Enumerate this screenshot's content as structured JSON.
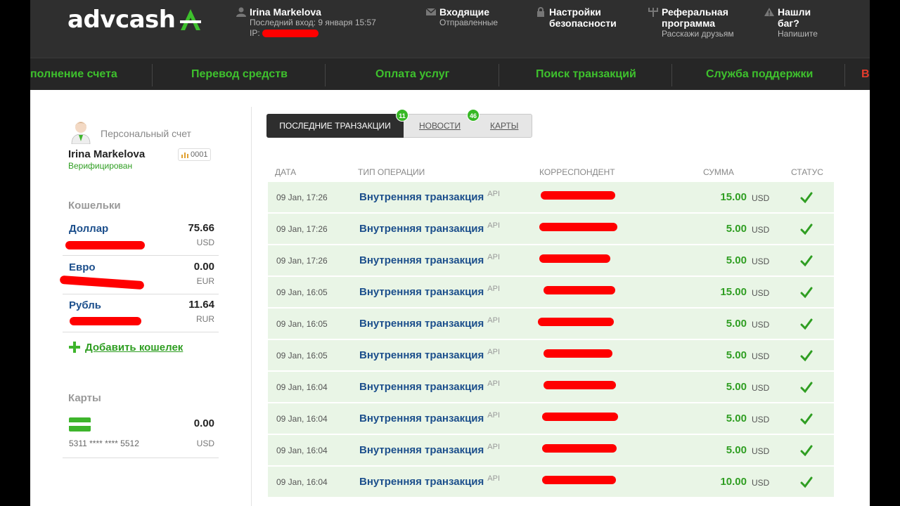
{
  "header": {
    "logo_text_1": "adv",
    "logo_text_2": "cash",
    "user_name": "Irina Markelova",
    "last_login": "Последний вход: 9 января 15:57",
    "ip_label": "IP:",
    "inbox_title": "Входящие",
    "inbox_sub": "Отправленные",
    "security_line1": "Настройки",
    "security_line2": "безопасности",
    "referral_line1": "Реферальная",
    "referral_line2": "программа",
    "referral_sub": "Расскажи друзьям",
    "bug_line1": "Нашли",
    "bug_line2": "баг?",
    "bug_sub": "Напишите"
  },
  "nav": {
    "items": [
      {
        "label": "полнение счета"
      },
      {
        "label": "Перевод средств"
      },
      {
        "label": "Оплата услуг"
      },
      {
        "label": "Поиск транзакций"
      },
      {
        "label": "Служба поддержки"
      },
      {
        "label": "В"
      }
    ]
  },
  "account": {
    "type": "Персональный счет",
    "name": "Irina Markelova",
    "status": "Верифицирован",
    "id": "0001"
  },
  "wallets": {
    "title": "Кошельки",
    "items": [
      {
        "name": "Доллар",
        "value": "75.66",
        "currency": "USD"
      },
      {
        "name": "Евро",
        "value": "0.00",
        "currency": "EUR"
      },
      {
        "name": "Рубль",
        "value": "11.64",
        "currency": "RUR"
      }
    ],
    "add_label": "Добавить кошелек"
  },
  "cards": {
    "title": "Карты",
    "number": "5311 **** **** 5512",
    "value": "0.00",
    "currency": "USD"
  },
  "tabs": {
    "last": "ПОСЛЕДНИЕ ТРАНЗАКЦИИ",
    "last_count": "11",
    "news": "НОВОСТИ",
    "news_count": "46",
    "cards": "КАРТЫ"
  },
  "table": {
    "headers": {
      "date": "ДАТА",
      "type": "ТИП ОПЕРАЦИИ",
      "correspondent": "КОРРЕСПОНДЕНТ",
      "amount": "СУММА",
      "status": "СТАТУС"
    },
    "rows": [
      {
        "date": "09 Jan, 17:26",
        "type": "Внутренняя транзакция",
        "api": "API",
        "amount": "15.00",
        "currency": "USD"
      },
      {
        "date": "09 Jan, 17:26",
        "type": "Внутренняя транзакция",
        "api": "API",
        "amount": "5.00",
        "currency": "USD"
      },
      {
        "date": "09 Jan, 17:26",
        "type": "Внутренняя транзакция",
        "api": "API",
        "amount": "5.00",
        "currency": "USD"
      },
      {
        "date": "09 Jan, 16:05",
        "type": "Внутренняя транзакция",
        "api": "API",
        "amount": "15.00",
        "currency": "USD"
      },
      {
        "date": "09 Jan, 16:05",
        "type": "Внутренняя транзакция",
        "api": "API",
        "amount": "5.00",
        "currency": "USD"
      },
      {
        "date": "09 Jan, 16:05",
        "type": "Внутренняя транзакция",
        "api": "API",
        "amount": "5.00",
        "currency": "USD"
      },
      {
        "date": "09 Jan, 16:04",
        "type": "Внутренняя транзакция",
        "api": "API",
        "amount": "5.00",
        "currency": "USD"
      },
      {
        "date": "09 Jan, 16:04",
        "type": "Внутренняя транзакция",
        "api": "API",
        "amount": "5.00",
        "currency": "USD"
      },
      {
        "date": "09 Jan, 16:04",
        "type": "Внутренняя транзакция",
        "api": "API",
        "amount": "5.00",
        "currency": "USD"
      },
      {
        "date": "09 Jan, 16:04",
        "type": "Внутренняя транзакция",
        "api": "API",
        "amount": "10.00",
        "currency": "USD"
      }
    ]
  },
  "colors": {
    "brand_green": "#3ec12d",
    "link_blue": "#1c4f8c",
    "redaction": "#ff0000"
  }
}
